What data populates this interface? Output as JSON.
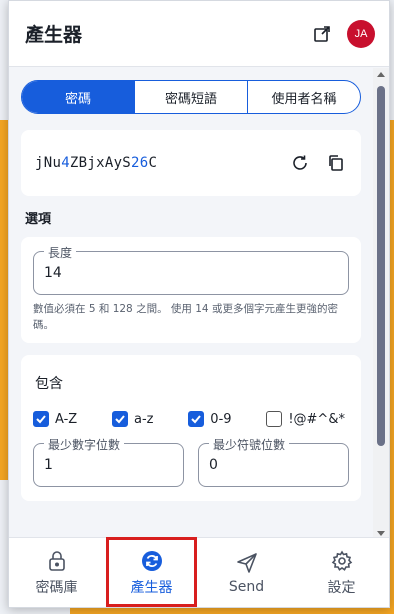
{
  "header": {
    "title": "產生器",
    "avatar": "JA"
  },
  "tabs": [
    {
      "label": "密碼",
      "active": true
    },
    {
      "label": "密碼短語",
      "active": false
    },
    {
      "label": "使用者名稱",
      "active": false
    }
  ],
  "password": {
    "segments": [
      {
        "text": "jNu",
        "num": false
      },
      {
        "text": "4",
        "num": true
      },
      {
        "text": "ZBjxAyS",
        "num": false
      },
      {
        "text": "26",
        "num": true
      },
      {
        "text": "C",
        "num": false
      }
    ]
  },
  "options": {
    "section_label": "選項",
    "length_label": "長度",
    "length_value": "14",
    "hint": "數值必須在 5 和 128 之間。 使用 14 或更多個字元產生更強的密碼。"
  },
  "include": {
    "title": "包含",
    "checks": [
      {
        "label": "A-Z",
        "checked": true
      },
      {
        "label": "a-z",
        "checked": true
      },
      {
        "label": "0-9",
        "checked": true
      },
      {
        "label": "!@#^&*",
        "checked": false
      }
    ],
    "min_numbers_label": "最少數字位數",
    "min_numbers_value": "1",
    "min_special_label": "最少符號位數",
    "min_special_value": "0"
  },
  "nav": [
    {
      "label": "密碼庫",
      "icon": "lock-icon",
      "active": false
    },
    {
      "label": "產生器",
      "icon": "generator-icon",
      "active": true
    },
    {
      "label": "Send",
      "icon": "send-icon",
      "active": false
    },
    {
      "label": "設定",
      "icon": "gear-icon",
      "active": false
    }
  ],
  "colors": {
    "accent": "#175ddc",
    "avatar": "#c8102e",
    "highlight": "#d81e1e"
  }
}
